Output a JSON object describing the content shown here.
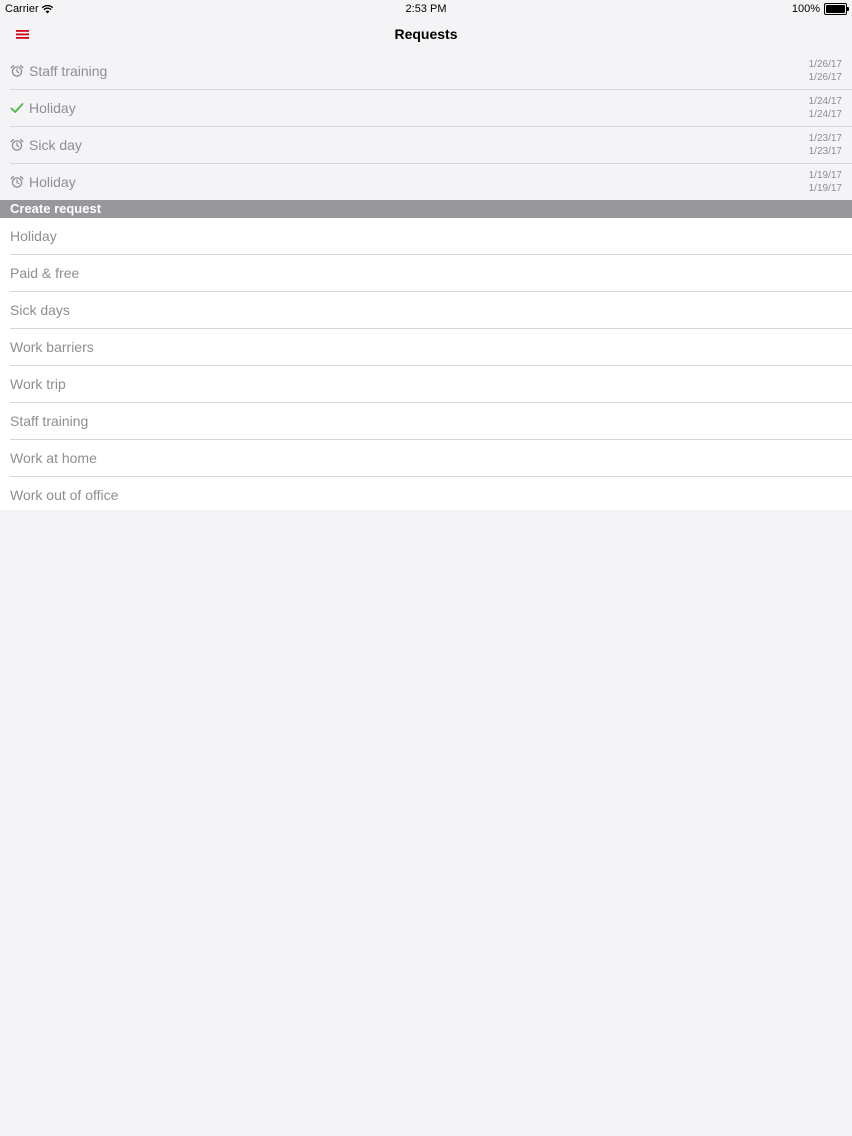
{
  "status_bar": {
    "carrier": "Carrier",
    "time": "2:53 PM",
    "battery": "100%",
    "battery_level": 1.0
  },
  "nav": {
    "title": "Requests",
    "menu_icon": "hamburger-menu-icon",
    "accent_color": "#d0021b"
  },
  "requests": [
    {
      "label": "Staff training",
      "status_icon": "alarm-clock-icon",
      "start": "1/26/17",
      "end": "1/26/17"
    },
    {
      "label": "Holiday",
      "status_icon": "checkmark-icon",
      "start": "1/24/17",
      "end": "1/24/17"
    },
    {
      "label": "Sick day",
      "status_icon": "alarm-clock-icon",
      "start": "1/23/17",
      "end": "1/23/17"
    },
    {
      "label": "Holiday",
      "status_icon": "alarm-clock-icon",
      "start": "1/19/17",
      "end": "1/19/17"
    }
  ],
  "create_section": {
    "header": "Create request",
    "items": [
      "Holiday",
      "Paid & free",
      "Sick days",
      "Work barriers",
      "Work trip",
      "Staff training",
      "Work at home",
      "Work out of office"
    ]
  },
  "colors": {
    "approved": "#4cb848",
    "pending": "#8e8e93",
    "section_header": "#98979c"
  }
}
